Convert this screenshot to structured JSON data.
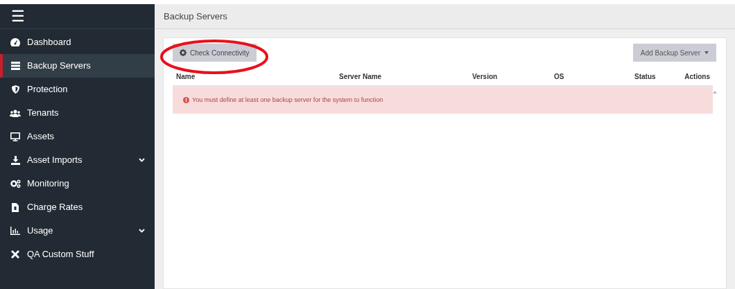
{
  "sidebar": {
    "menu_icon": "☰",
    "items": [
      {
        "label": "Dashboard",
        "selected": false,
        "expandable": false
      },
      {
        "label": "Backup Servers",
        "selected": true,
        "expandable": false
      },
      {
        "label": "Protection",
        "selected": false,
        "expandable": false
      },
      {
        "label": "Tenants",
        "selected": false,
        "expandable": false
      },
      {
        "label": "Assets",
        "selected": false,
        "expandable": false
      },
      {
        "label": "Asset Imports",
        "selected": false,
        "expandable": true
      },
      {
        "label": "Monitoring",
        "selected": false,
        "expandable": false
      },
      {
        "label": "Charge Rates",
        "selected": false,
        "expandable": false
      },
      {
        "label": "Usage",
        "selected": false,
        "expandable": true
      },
      {
        "label": "QA Custom Stuff",
        "selected": false,
        "expandable": false
      }
    ]
  },
  "page_title": "Backup Servers",
  "toolbar": {
    "check_button": "Check Connectivity",
    "add_button": "Add Backup Server"
  },
  "table": {
    "columns": [
      "Name",
      "Server Name",
      "Version",
      "OS",
      "Status",
      "Actions"
    ],
    "alert": "You must define at least one backup server for the system to function"
  }
}
